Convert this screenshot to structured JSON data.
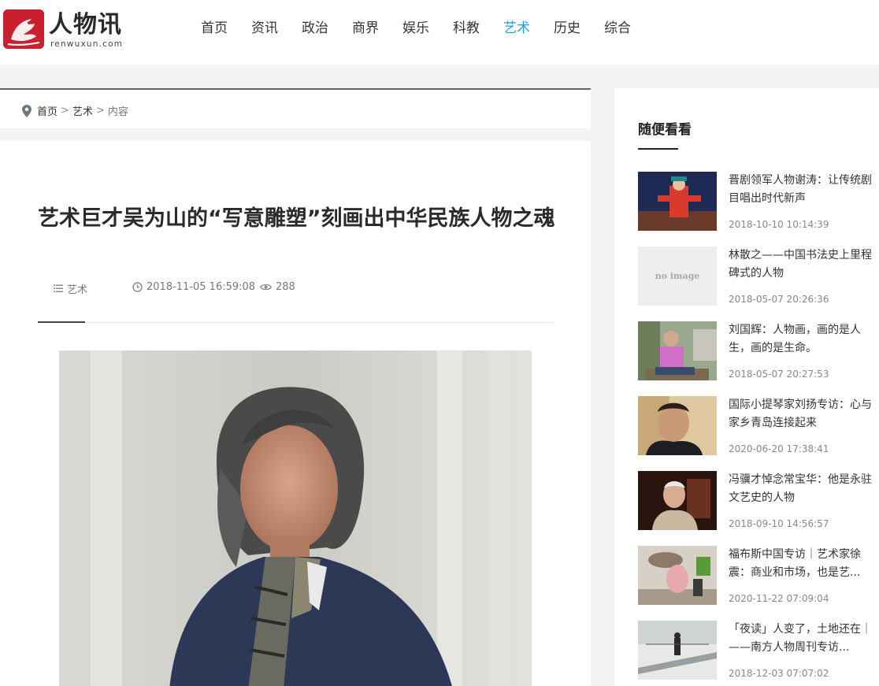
{
  "site": {
    "logo_text": "人物讯",
    "logo_sub": "renwuxun.com"
  },
  "nav": {
    "items": [
      "首页",
      "资讯",
      "政治",
      "商界",
      "娱乐",
      "科教",
      "艺术",
      "历史",
      "综合"
    ],
    "active": "艺术"
  },
  "breadcrumb": {
    "home": "首页",
    "sep1": ">",
    "category": "艺术",
    "sep2": ">",
    "current": "内容"
  },
  "article": {
    "title": "艺术巨才吴为山的“写意雕塑”刻画出中华民族人物之魂",
    "category": "艺术",
    "datetime": "2018-11-05 16:59:08",
    "views": "288",
    "icons": {
      "category": "list-icon",
      "time": "clock-icon",
      "views": "eye-icon"
    }
  },
  "sidebar": {
    "title": "随便看看",
    "items": [
      {
        "title": "晋剧领军人物谢涛：让传统剧目唱出时代新声",
        "date": "2018-10-10 10:14:39"
      },
      {
        "title": "林散之——中国书法史上里程碑式的人物",
        "date": "2018-05-07 20:26:36",
        "thumb_text": "no image"
      },
      {
        "title": "刘国辉：人物画，画的是人生，画的是生命。",
        "date": "2018-05-07 20:27:53"
      },
      {
        "title": "国际小提琴家刘扬专访：心与家乡青岛连接起来",
        "date": "2020-06-20 17:38:41"
      },
      {
        "title": "冯骥才悼念常宝华：他是永驻文艺史的人物",
        "date": "2018-09-10 14:56:57"
      },
      {
        "title": "福布斯中国专访｜艺术家徐震：商业和市场，也是艺...",
        "date": "2020-11-22 07:09:04"
      },
      {
        "title": "「夜读」人变了，土地还在｜——南方人物周刊专访...",
        "date": "2018-12-03 07:07:02"
      }
    ]
  },
  "colors": {
    "accent": "#1fa2d2",
    "brand": "#c8202f",
    "text": "#333333"
  }
}
